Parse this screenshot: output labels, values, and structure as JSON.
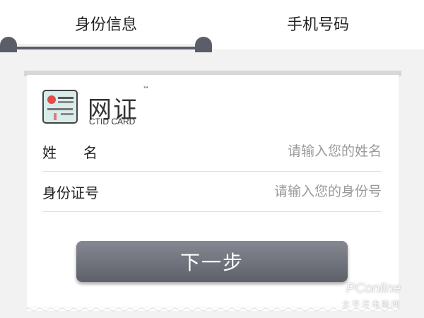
{
  "tabs": [
    {
      "label": "身份信息",
      "active": true
    },
    {
      "label": "手机号码",
      "active": false
    }
  ],
  "logo": {
    "title": "网证",
    "trademark": "™",
    "subtitle": "CTID CARD",
    "icon": "id-card-icon"
  },
  "form": {
    "name": {
      "label": "姓名",
      "placeholder": "请输入您的姓名",
      "value": ""
    },
    "id_number": {
      "label": "身份证号",
      "placeholder": "请输入您的身份号",
      "value": ""
    }
  },
  "next_button": {
    "label": "下一步"
  },
  "watermark": {
    "text": "PConline",
    "subtext": "太平洋电脑网"
  },
  "colors": {
    "tab_indicator": "#5b5e68",
    "button": "#6b6e77",
    "background": "#f2f2f2",
    "placeholder": "#9a9a9a"
  }
}
